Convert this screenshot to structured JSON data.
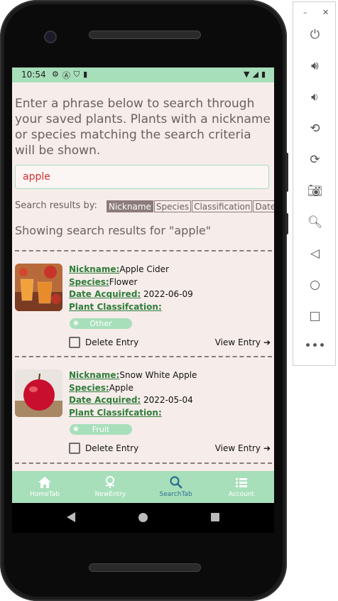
{
  "status_bar": {
    "time": "10:54"
  },
  "search_page": {
    "intro_text": "Enter a phrase below to search through your saved plants. Plants with a nickname or species matching the search criteria will be shown.",
    "search_value": "apple",
    "filter_label": "Search results by:",
    "filters": [
      "Nickname",
      "Species",
      "Classification",
      "Date"
    ],
    "active_filter": "Nickname",
    "results_heading": "Showing search results for \"apple\""
  },
  "labels": {
    "nickname": "Nickname:",
    "species": "Species:",
    "date_acquired": "Date Acquired:",
    "classification": "Plant Classifcation:",
    "delete_entry": "Delete Entry",
    "view_entry": "View Entry"
  },
  "entries": [
    {
      "nickname": "Apple Cider",
      "species": "Flower",
      "date_acquired": "2022-06-09",
      "classification": "Other"
    },
    {
      "nickname": "Snow White Apple",
      "species": "Apple",
      "date_acquired": "2022-05-04",
      "classification": "Fruit"
    }
  ],
  "bottom_nav": [
    {
      "label": "HomeTab",
      "icon": "home-icon"
    },
    {
      "label": "NewEntry",
      "icon": "plant-add-icon"
    },
    {
      "label": "SearchTab",
      "icon": "search-icon"
    },
    {
      "label": "Account",
      "icon": "list-icon"
    }
  ],
  "active_tab": "SearchTab",
  "colors": {
    "accent": "#a8dfbb",
    "background": "#f6ecea",
    "label_green": "#2f7d3a",
    "muted_brown": "#8c7b7b",
    "search_text": "#d32f2f"
  }
}
